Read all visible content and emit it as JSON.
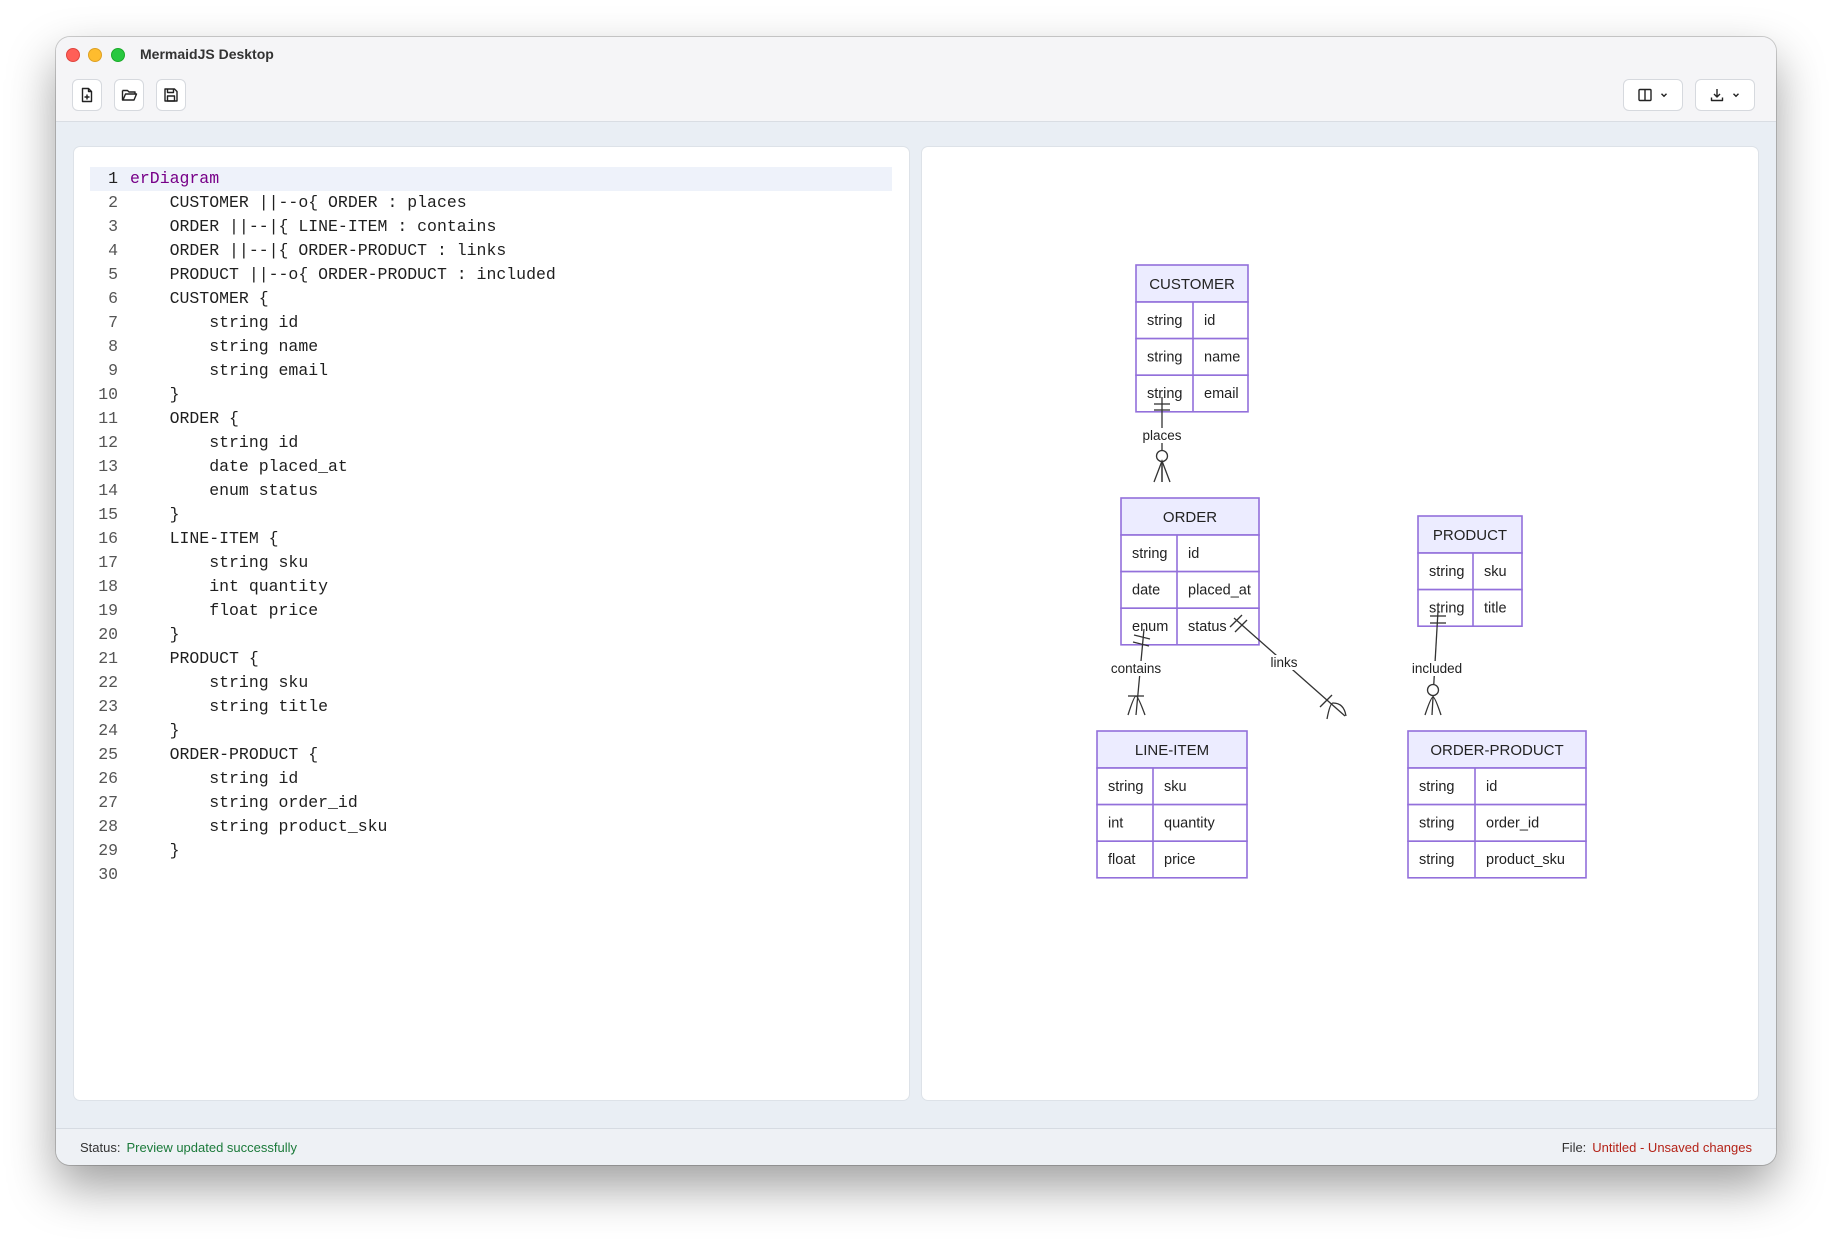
{
  "window": {
    "title": "MermaidJS Desktop"
  },
  "toolbar": {
    "new_icon": "file-plus-icon",
    "open_icon": "folder-open-icon",
    "save_icon": "save-icon",
    "layout_icon": "layout-columns-icon",
    "export_icon": "download-icon"
  },
  "editor": {
    "active_line": 1,
    "lines": [
      "erDiagram",
      "    CUSTOMER ||--o{ ORDER : places",
      "    ORDER ||--|{ LINE-ITEM : contains",
      "    ORDER ||--|{ ORDER-PRODUCT : links",
      "    PRODUCT ||--o{ ORDER-PRODUCT : included",
      "    CUSTOMER {",
      "        string id",
      "        string name",
      "        string email",
      "    }",
      "    ORDER {",
      "        string id",
      "        date placed_at",
      "        enum status",
      "    }",
      "    LINE-ITEM {",
      "        string sku",
      "        int quantity",
      "        float price",
      "    }",
      "    PRODUCT {",
      "        string sku",
      "        string title",
      "    }",
      "    ORDER-PRODUCT {",
      "        string id",
      "        string order_id",
      "        string product_sku",
      "    }",
      ""
    ]
  },
  "diagram": {
    "entities": [
      {
        "name": "CUSTOMER",
        "attributes": [
          [
            "string",
            "id"
          ],
          [
            "string",
            "name"
          ],
          [
            "string",
            "email"
          ]
        ]
      },
      {
        "name": "ORDER",
        "attributes": [
          [
            "string",
            "id"
          ],
          [
            "date",
            "placed_at"
          ],
          [
            "enum",
            "status"
          ]
        ]
      },
      {
        "name": "PRODUCT",
        "attributes": [
          [
            "string",
            "sku"
          ],
          [
            "string",
            "title"
          ]
        ]
      },
      {
        "name": "LINE-ITEM",
        "attributes": [
          [
            "string",
            "sku"
          ],
          [
            "int",
            "quantity"
          ],
          [
            "float",
            "price"
          ]
        ]
      },
      {
        "name": "ORDER-PRODUCT",
        "attributes": [
          [
            "string",
            "id"
          ],
          [
            "string",
            "order_id"
          ],
          [
            "string",
            "product_sku"
          ]
        ]
      }
    ],
    "relations": [
      {
        "label": "places"
      },
      {
        "label": "contains"
      },
      {
        "label": "links"
      },
      {
        "label": "included"
      }
    ],
    "colors": {
      "header_fill": "#ececff",
      "row_fill": "#ffffff",
      "border": "#9370db",
      "line": "#333333"
    }
  },
  "status": {
    "label": "Status:",
    "message": "Preview updated successfully",
    "file_label": "File:",
    "file_value": "Untitled - Unsaved changes"
  }
}
